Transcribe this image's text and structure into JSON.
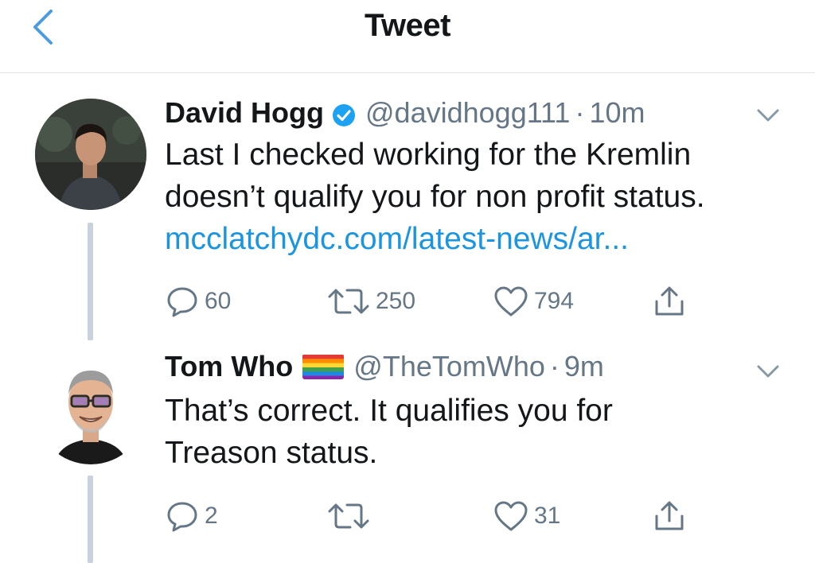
{
  "header": {
    "title": "Tweet"
  },
  "tweets": [
    {
      "name": "David Hogg",
      "verified": true,
      "handle": "@davidhogg111",
      "separator": "·",
      "time": "10m",
      "text_lines": [
        "Last I checked working for the Kremlin",
        "doesn’t qualify you for non profit status."
      ],
      "link": "mcclatchydc.com/latest-news/ar...",
      "actions": {
        "replies": "60",
        "retweets": "250",
        "likes": "794"
      }
    },
    {
      "name": "Tom Who",
      "emoji": "rainbow-flag",
      "handle": "@TheTomWho",
      "separator": "·",
      "time": "9m",
      "text_lines": [
        "That’s correct. It qualifies you for",
        "Treason status."
      ],
      "actions": {
        "replies": "2",
        "retweets": "",
        "likes": "31"
      }
    }
  ],
  "colors": {
    "link": "#1b95e0",
    "verified": "#1da1f2",
    "secondary_text": "#657786",
    "thread_line": "#c8d2dc"
  },
  "icons": [
    "back-chevron-icon",
    "verified-badge-icon",
    "caret-down-icon",
    "reply-icon",
    "retweet-icon",
    "like-icon",
    "share-icon"
  ]
}
